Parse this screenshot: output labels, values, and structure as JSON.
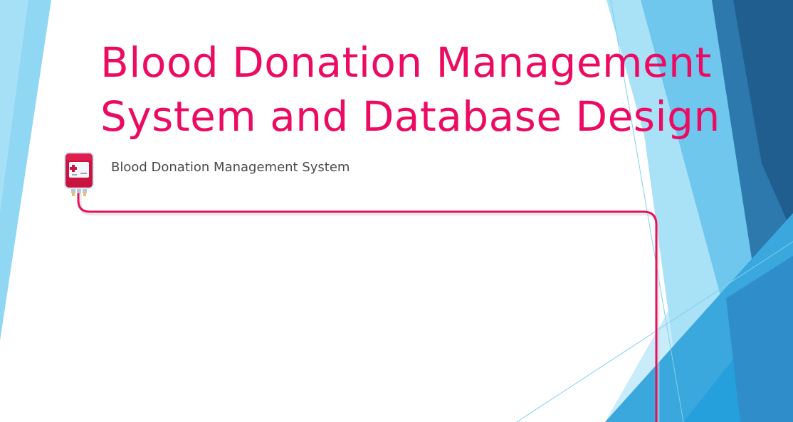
{
  "slide": {
    "title_line1": "Blood Donation Management",
    "title_line2": "System and Database Design",
    "subtitle": "Blood Donation Management System"
  },
  "colors": {
    "accent": "#ec0b63",
    "subtitle": "#4a4a4a",
    "light_blue": "#8fd7f3",
    "mid_blue": "#3aa7dd",
    "dark_blue": "#236a9c",
    "background": "#ffffff"
  },
  "icons": {
    "blood_bag": "blood-bag-icon"
  }
}
